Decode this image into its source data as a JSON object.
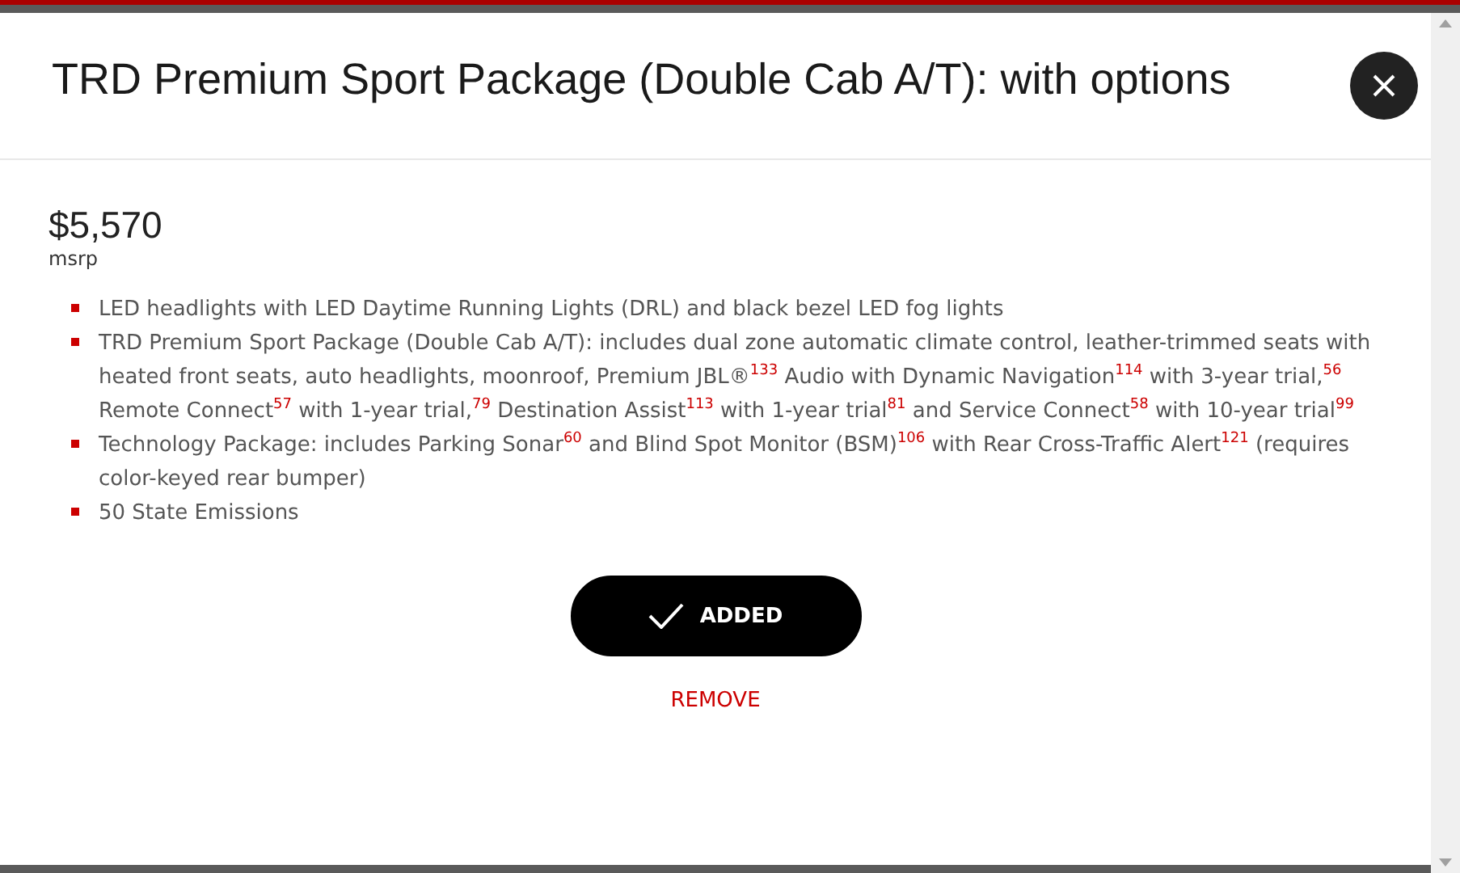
{
  "modal": {
    "title": "TRD Premium Sport Package (Double Cab A/T): with options",
    "price": "$5,570",
    "price_label": "msrp",
    "features": [
      "LED headlights with LED Daytime Running Lights (DRL) and black bezel LED fog lights",
      "TRD Premium Sport Package (Double Cab A/T): includes dual zone automatic climate control, leather-trimmed seats with heated front seats, auto headlights, moonroof, Premium JBL®$^{133}$ Audio with Dynamic Navigation$^{114}$ with 3-year trial,$^{56}$ Remote Connect$^{57}$ with 1-year trial,$^{79}$ Destination Assist$^{113}$ with 1-year trial$^{81}$ and Service Connect$^{58}$ with 10-year trial$^{99}$",
      "Technology Package: includes Parking Sonar$^{60}$ and Blind Spot Monitor (BSM)$^{106}$ with Rear Cross-Traffic Alert$^{121}$ (requires color-keyed rear bumper)",
      "50 State Emissions"
    ],
    "added_button": {
      "label": "ADDED",
      "selected": true
    },
    "remove_link": "REMOVE"
  }
}
